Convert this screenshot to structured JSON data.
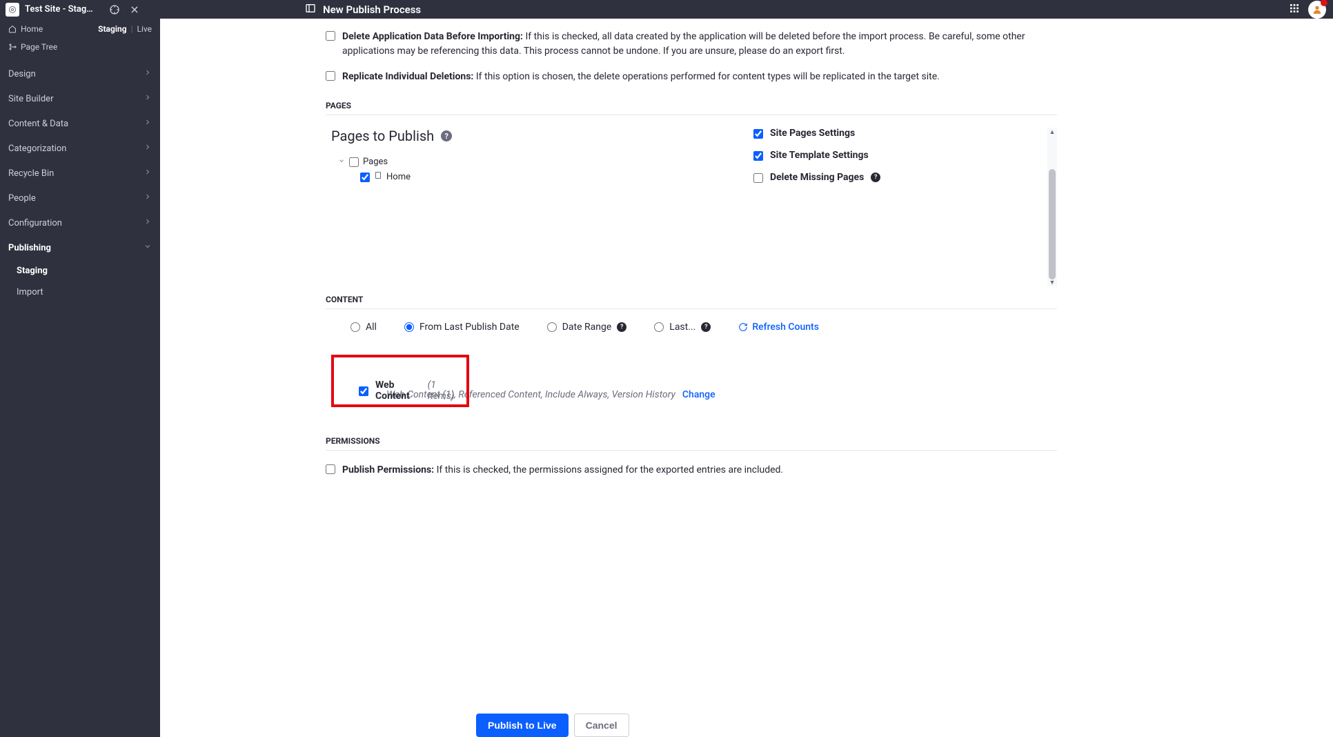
{
  "header": {
    "site_title": "Test Site - Stagi...",
    "page_title": "New Publish Process"
  },
  "sidebar": {
    "home_label": "Home",
    "staging_label": "Staging",
    "live_label": "Live",
    "page_tree_label": "Page Tree",
    "items": [
      {
        "label": "Design"
      },
      {
        "label": "Site Builder"
      },
      {
        "label": "Content & Data"
      },
      {
        "label": "Categorization"
      },
      {
        "label": "Recycle Bin"
      },
      {
        "label": "People"
      },
      {
        "label": "Configuration"
      },
      {
        "label": "Publishing"
      }
    ],
    "subitems": [
      {
        "label": "Staging"
      },
      {
        "label": "Import"
      }
    ]
  },
  "deletion": {
    "delete_app_label": "Delete Application Data Before Importing:",
    "delete_app_desc": "If this is checked, all data created by the application will be deleted before the import process. Be careful, some other applications may be referencing this data. This process cannot be undone. If you are unsure, please do an export first.",
    "replicate_label": "Replicate Individual Deletions:",
    "replicate_desc": "If this option is chosen, the delete operations performed for content types will be replicated in the target site."
  },
  "pages": {
    "heading": "PAGES",
    "title": "Pages to Publish",
    "tree_root": "Pages",
    "tree_home": "Home",
    "site_pages_settings": "Site Pages Settings",
    "site_template_settings": "Site Template Settings",
    "delete_missing_pages": "Delete Missing Pages"
  },
  "content": {
    "heading": "CONTENT",
    "radio_all": "All",
    "radio_from_last": "From Last Publish Date",
    "radio_date_range": "Date Range",
    "radio_last": "Last...",
    "refresh": "Refresh Counts",
    "web_content_label": "Web Content",
    "web_content_count": "(1 Items)",
    "web_content_detail": "Web Content (1), Referenced Content, Include Always, Version History",
    "change": "Change"
  },
  "permissions": {
    "heading": "PERMISSIONS",
    "publish_perm_label": "Publish Permissions:",
    "publish_perm_desc": "If this is checked, the permissions assigned for the exported entries are included."
  },
  "footer": {
    "publish": "Publish to Live",
    "cancel": "Cancel"
  }
}
